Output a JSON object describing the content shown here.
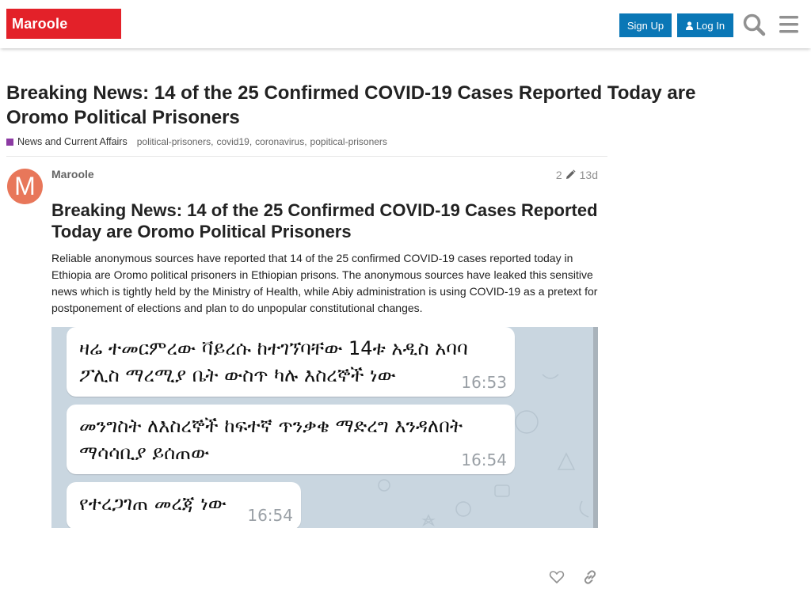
{
  "header": {
    "logo_text": "Maroole",
    "signup_label": "Sign Up",
    "login_label": "Log In",
    "search_icon": "search-icon",
    "menu_icon": "hamburger-menu-icon",
    "brand_color": "#e32129",
    "button_color": "#0a77b6"
  },
  "topic": {
    "title": "Breaking News: 14 of the 25 Confirmed COVID-19 Cases Reported Today are Oromo Political Prisoners",
    "category": "News and Current Affairs",
    "category_color": "#8c3ba3",
    "tags": [
      "political-prisoners",
      "covid19",
      "coronavirus",
      "popitical-prisoners"
    ]
  },
  "post": {
    "avatar_letter": "M",
    "avatar_color": "#e8775a",
    "username": "Maroole",
    "edit_count": "2",
    "age": "13d",
    "heading": "Breaking News: 14 of the 25 Confirmed COVID-19 Cases Reported Today are Oromo Political Prisoners",
    "body": "Reliable anonymous sources have reported that 14 of the 25 confirmed COVID-19 cases reported today in Ethiopia are Oromo political prisoners in Ethiopian prisons. The anonymous sources have leaked this sensitive news which is tightly held by the Ministry of Health, while Abiy administration is using COVID-19 as a pretext for postponement of elections and plan to do unpopular constitutional changes.",
    "image": {
      "messages": [
        {
          "line1": "ዛሬ ተመርምረው ቫይረሱ ከተገኘባቸው 14ቱ አዲስ አባባ",
          "line2": "ፖሊስ ማረሚያ ቤት ውስጥ ካሉ እስረኞች ነው",
          "time": "16:53"
        },
        {
          "line1": "መንግስት ለእስረኞች ከፍተኛ ጥንቃቄ ማድረግ እንዳለበት",
          "line2": "ማሳሳቢያ ይሰጠው",
          "time": "16:54"
        },
        {
          "line1": "የተረጋገጠ መረጃ ነው",
          "line2": "",
          "time": "16:54"
        }
      ]
    },
    "actions": {
      "like_icon": "heart-icon",
      "share_icon": "link-icon"
    }
  }
}
